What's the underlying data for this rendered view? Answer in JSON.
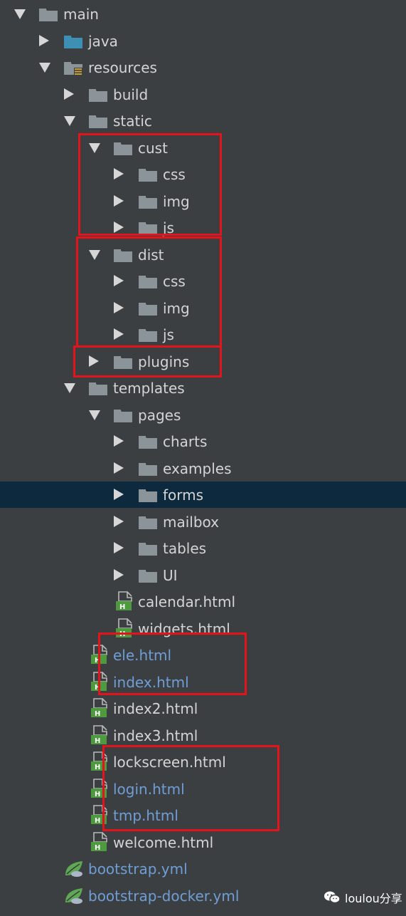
{
  "project_tree": {
    "items": [
      {
        "label": "main",
        "type": "folder",
        "expanded": true
      },
      {
        "label": "java",
        "type": "folder-source",
        "expanded": false
      },
      {
        "label": "resources",
        "type": "folder-resources",
        "expanded": true
      },
      {
        "label": "build",
        "type": "folder",
        "expanded": false
      },
      {
        "label": "static",
        "type": "folder",
        "expanded": true
      },
      {
        "label": "cust",
        "type": "folder",
        "expanded": true
      },
      {
        "label": "css",
        "type": "folder",
        "expanded": false
      },
      {
        "label": "img",
        "type": "folder",
        "expanded": false
      },
      {
        "label": "js",
        "type": "folder",
        "expanded": false
      },
      {
        "label": "dist",
        "type": "folder",
        "expanded": true
      },
      {
        "label": "css",
        "type": "folder",
        "expanded": false
      },
      {
        "label": "img",
        "type": "folder",
        "expanded": false
      },
      {
        "label": "js",
        "type": "folder",
        "expanded": false
      },
      {
        "label": "plugins",
        "type": "folder",
        "expanded": false
      },
      {
        "label": "templates",
        "type": "folder",
        "expanded": true
      },
      {
        "label": "pages",
        "type": "folder",
        "expanded": true
      },
      {
        "label": "charts",
        "type": "folder",
        "expanded": false
      },
      {
        "label": "examples",
        "type": "folder",
        "expanded": false
      },
      {
        "label": "forms",
        "type": "folder",
        "expanded": false,
        "selected": true
      },
      {
        "label": "mailbox",
        "type": "folder",
        "expanded": false
      },
      {
        "label": "tables",
        "type": "folder",
        "expanded": false
      },
      {
        "label": "UI",
        "type": "folder",
        "expanded": false
      },
      {
        "label": "calendar.html",
        "type": "html-file"
      },
      {
        "label": "widgets.html",
        "type": "html-file"
      },
      {
        "label": "ele.html",
        "type": "html-file",
        "modified": true
      },
      {
        "label": "index.html",
        "type": "html-file",
        "modified": true
      },
      {
        "label": "index2.html",
        "type": "html-file"
      },
      {
        "label": "index3.html",
        "type": "html-file"
      },
      {
        "label": "lockscreen.html",
        "type": "html-file"
      },
      {
        "label": "login.html",
        "type": "html-file",
        "modified": true
      },
      {
        "label": "tmp.html",
        "type": "html-file",
        "modified": true
      },
      {
        "label": "welcome.html",
        "type": "html-file"
      },
      {
        "label": "bootstrap.yml",
        "type": "yml-file",
        "modified": true
      },
      {
        "label": "bootstrap-docker.yml",
        "type": "yml-file",
        "modified": true
      }
    ]
  },
  "watermark": {
    "text": "loulou分享",
    "icon": "wechat-icon"
  },
  "colors": {
    "background": "#3c3f41",
    "selected_row": "#0d293e",
    "text": "#d4d4d4",
    "modified_text": "#6f9ed6",
    "folder": "#8a9499",
    "source_folder": "#3d8fb3",
    "html_icon": "#4e9a3e",
    "yml_icon": "#5fa854",
    "highlight_box": "#e3141b"
  }
}
